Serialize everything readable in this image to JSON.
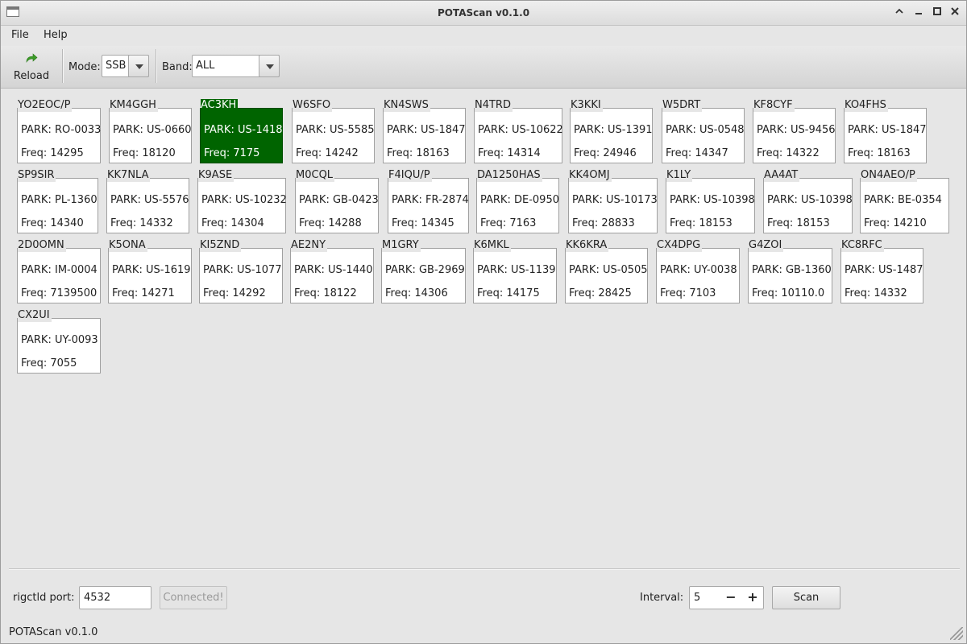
{
  "window": {
    "title": "POTAScan v0.1.0"
  },
  "menu": [
    "File",
    "Help"
  ],
  "toolbar": {
    "reload_label": "Reload",
    "mode_label": "Mode:",
    "mode_value": "SSB",
    "band_label": "Band:",
    "band_value": "ALL"
  },
  "spot_labels": {
    "park_prefix": "PARK: ",
    "freq_prefix": "Freq: "
  },
  "rows": [
    [
      {
        "call": "YO2EOC/P",
        "park": "RO-0033",
        "freq": "14295"
      },
      {
        "call": "KM4GGH",
        "park": "US-0660",
        "freq": "18120"
      },
      {
        "call": "AC3KH",
        "park": "US-1418",
        "freq": "7175",
        "selected": true
      },
      {
        "call": "W6SFO",
        "park": "US-5585",
        "freq": "14242"
      },
      {
        "call": "KN4SWS",
        "park": "US-1847",
        "freq": "18163"
      },
      {
        "call": "N4TRD",
        "park": "US-10622",
        "freq": "14314"
      },
      {
        "call": "K3KKI",
        "park": "US-1391",
        "freq": "24946"
      },
      {
        "call": "W5DRT",
        "park": "US-0548",
        "freq": "14347"
      },
      {
        "call": "KF8CYF",
        "park": "US-9456",
        "freq": "14322"
      },
      {
        "call": "KO4FHS",
        "park": "US-1847",
        "freq": "18163"
      }
    ],
    [
      {
        "call": "SP9SIR",
        "park": "PL-1360",
        "freq": "14340"
      },
      {
        "call": "KK7NLA",
        "park": "US-5576",
        "freq": "14332"
      },
      {
        "call": "K9ASE",
        "park": "US-10232",
        "freq": "14304"
      },
      {
        "call": "M0CQL",
        "park": "GB-0423",
        "freq": "14288"
      },
      {
        "call": "F4IQU/P",
        "park": "FR-2874",
        "freq": "14345"
      },
      {
        "call": "DA1250HAS",
        "park": "DE-0950",
        "freq": "7163"
      },
      {
        "call": "KK4OMJ",
        "park": "US-10173",
        "freq": "28833"
      },
      {
        "call": "K1LY",
        "park": "US-10398",
        "freq": "18153"
      },
      {
        "call": "AA4AT",
        "park": "US-10398",
        "freq": "18153"
      },
      {
        "call": "ON4AEO/P",
        "park": "BE-0354",
        "freq": "14210"
      }
    ],
    [
      {
        "call": "2D0OMN",
        "park": "IM-0004",
        "freq": "7139500"
      },
      {
        "call": "K5ONA",
        "park": "US-1619",
        "freq": "14271"
      },
      {
        "call": "KI5ZND",
        "park": "US-1077",
        "freq": "14292"
      },
      {
        "call": "AE2NY",
        "park": "US-1440",
        "freq": "18122"
      },
      {
        "call": "M1GRY",
        "park": "GB-2969",
        "freq": "14306"
      },
      {
        "call": "K6MKL",
        "park": "US-1139",
        "freq": "14175"
      },
      {
        "call": "KK6KRA",
        "park": "US-0505",
        "freq": "28425"
      },
      {
        "call": "CX4DPG",
        "park": "UY-0038",
        "freq": "7103"
      },
      {
        "call": "G4ZOI",
        "park": "GB-1360",
        "freq": "10110.0"
      },
      {
        "call": "KC8RFC",
        "park": "US-1487",
        "freq": "14332"
      }
    ],
    [
      {
        "call": "CX2UI",
        "park": "UY-0093",
        "freq": "7055"
      }
    ]
  ],
  "bottom": {
    "port_label": "rigctld port:",
    "port_value": "4532",
    "connect_label": "Connected!",
    "interval_label": "Interval:",
    "interval_value": "5",
    "minus": "−",
    "plus": "+",
    "scan_label": "Scan"
  },
  "status": "POTAScan v0.1.0",
  "colors": {
    "selected": "#006400"
  }
}
